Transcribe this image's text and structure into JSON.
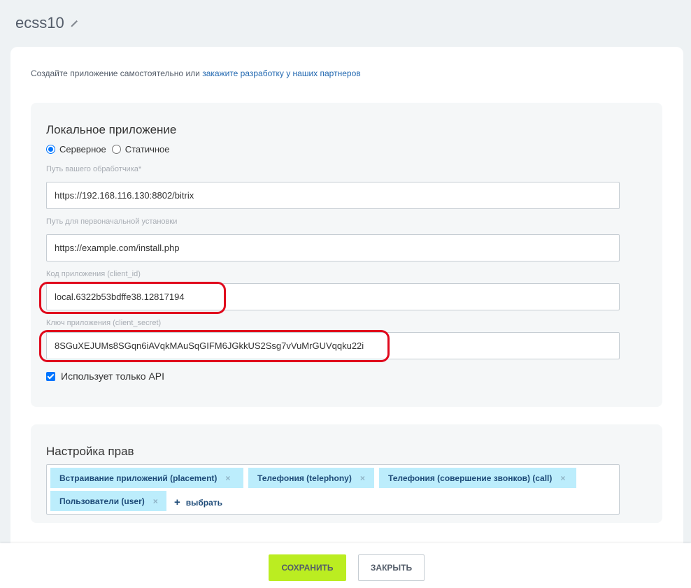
{
  "header": {
    "title": "ecss10"
  },
  "intro": {
    "text": "Создайте приложение самостоятельно или ",
    "link": "закажите разработку у наших партнеров"
  },
  "local_app": {
    "title": "Локальное приложение",
    "radio_server": "Серверное",
    "radio_static": "Статичное",
    "selected": "Серверное",
    "handler_label": "Путь вашего обработчика*",
    "handler_value": "https://192.168.116.130:8802/bitrix",
    "install_label": "Путь для первоначальной установки",
    "install_value": "https://example.com/install.php",
    "client_id_label": "Код приложения (client_id)",
    "client_id_value": "local.6322b53bdffe38.12817194",
    "client_secret_label": "Ключ приложения (client_secret)",
    "client_secret_value": "8SGuXEJUMs8SGqn6iAVqkMAuSqGIFM6JGkkUS2Ssg7vVuMrGUVqqku22i",
    "api_only_label": "Использует только API",
    "api_only_checked": true
  },
  "rights": {
    "title": "Настройка прав",
    "tags": [
      "Встраивание приложений (placement)",
      "Телефония (telephony)",
      "Телефония (совершение звонков) (call)",
      "Пользователи (user)"
    ],
    "add_label": "выбрать",
    "remove_glyph": "×",
    "add_glyph": "+"
  },
  "footer": {
    "save_label": "СОХРАНИТЬ",
    "close_label": "ЗАКРЫТЬ"
  },
  "colors": {
    "accent": "#bbed21",
    "link": "#2067b0",
    "tag_bg": "#bcedfc",
    "highlight": "#e0081c"
  }
}
